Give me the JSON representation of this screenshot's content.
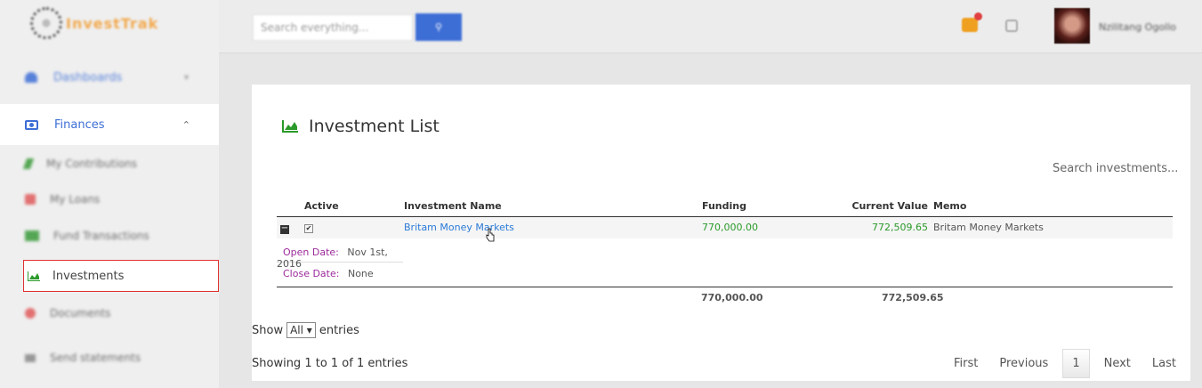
{
  "brand": {
    "logo_text": "InvestTrak"
  },
  "sidebar": {
    "dashboards": "Dashboards",
    "finances": "Finances",
    "sub": [
      "My Contributions",
      "My Loans",
      "Fund Transactions",
      "Investments",
      "Documents"
    ],
    "send_statements": "Send statements"
  },
  "topbar": {
    "search_placeholder": "Search everything...",
    "username": "Nzilitang Ogollo"
  },
  "panel": {
    "title": "Investment List",
    "search_label": "Search investments..."
  },
  "table": {
    "headers": [
      "Active",
      "Investment Name",
      "Funding",
      "Current Value",
      "Memo"
    ],
    "row": {
      "name": "Britam Money Markets",
      "funding": "770,000.00",
      "current_value": "772,509.65",
      "memo": "Britam Money Markets"
    },
    "details": {
      "open_label": "Open Date:",
      "open_value": "Nov 1st, 2016",
      "close_label": "Close Date:",
      "close_value": "None"
    },
    "totals": {
      "funding": "770,000.00",
      "current_value": "772,509.65"
    }
  },
  "footer": {
    "show": "Show",
    "select_value": "All",
    "entries": "entries",
    "showing": "Showing 1 to 1 of 1 entries",
    "pager": [
      "First",
      "Previous",
      "1",
      "Next",
      "Last"
    ]
  },
  "colors": {
    "accent": "#3d6ed6",
    "green": "#2a9a2a",
    "purple": "#9b2a9b",
    "highlight": "#e03030"
  }
}
